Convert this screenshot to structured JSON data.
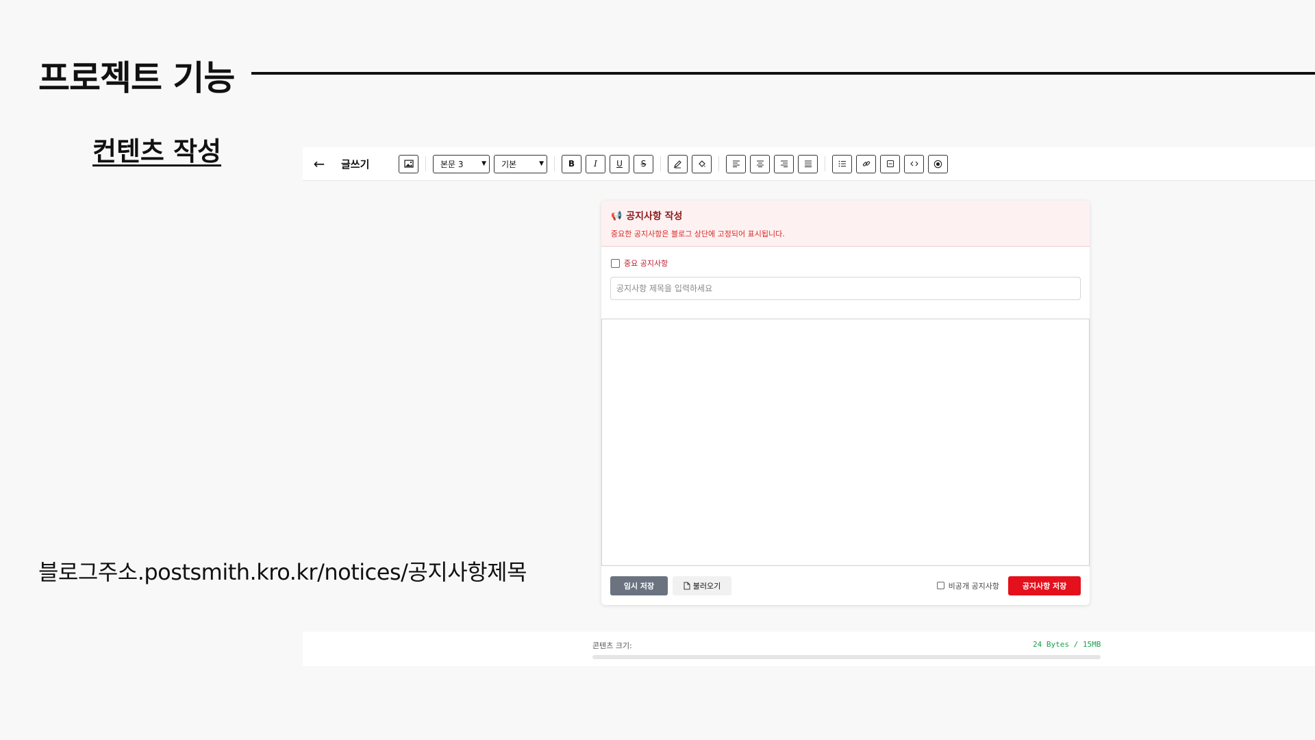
{
  "slide": {
    "title": "프로젝트 기능",
    "section_heading": "컨텐츠 작성",
    "url_caption": "블로그주소.postsmith.kro.kr/notices/공지사항제목"
  },
  "toolbar": {
    "back_icon": "←",
    "title": "글쓰기",
    "style_select": "본문 3",
    "font_select": "기본",
    "bold": "B",
    "italic": "I",
    "underline": "U",
    "strike": "S"
  },
  "notice": {
    "icon": "📢",
    "header_title": "공지사항 작성",
    "header_subtitle": "중요한 공지사항은 블로그 상단에 고정되어 표시됩니다.",
    "important_label": "중요 공지사항",
    "title_placeholder": "공지사항 제목을 입력하세요",
    "temp_save_label": "임시 저장",
    "load_label": "불러오기",
    "private_label": "비공개 공지사항",
    "save_label": "공지사항 저장"
  },
  "content_size": {
    "label": "콘텐츠 크기:",
    "value": "24 Bytes / 15MB",
    "fraction": 1.5e-06
  },
  "colors": {
    "accent_red": "#e4101c",
    "size_green": "#16a34a"
  }
}
